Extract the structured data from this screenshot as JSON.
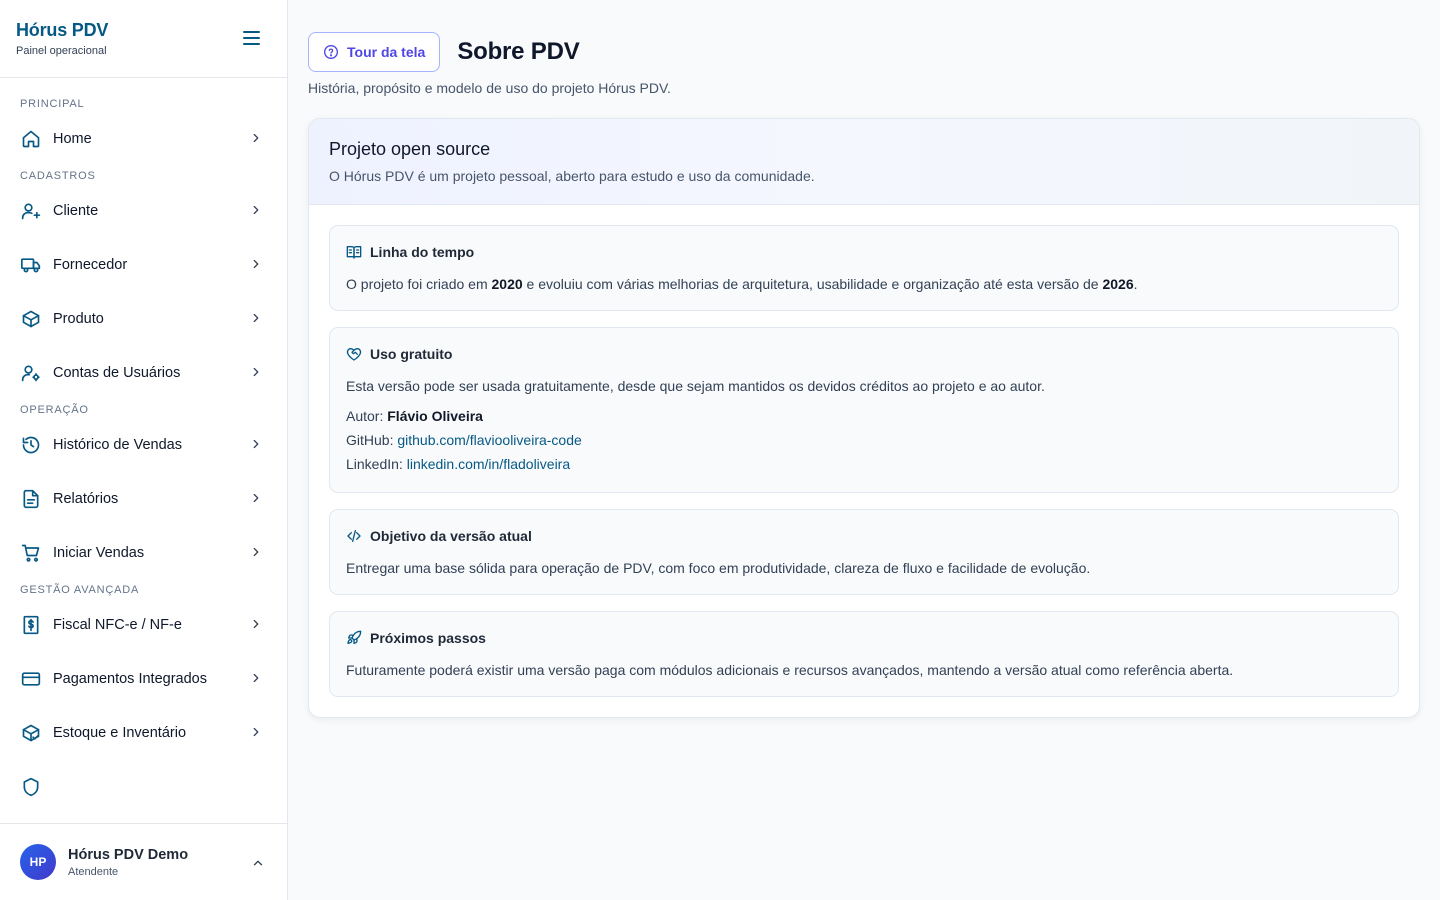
{
  "brand": {
    "title": "Hórus PDV",
    "subtitle": "Painel operacional"
  },
  "sidebar": {
    "sections": [
      {
        "title": "PRINCIPAL",
        "items": [
          {
            "label": "Home",
            "icon": "home-icon"
          }
        ]
      },
      {
        "title": "CADASTROS",
        "items": [
          {
            "label": "Cliente",
            "icon": "user-plus-icon"
          },
          {
            "label": "Fornecedor",
            "icon": "truck-icon"
          },
          {
            "label": "Produto",
            "icon": "package-icon"
          },
          {
            "label": "Contas de Usuários",
            "icon": "user-cog-icon"
          }
        ]
      },
      {
        "title": "OPERAÇÃO",
        "items": [
          {
            "label": "Histórico de Vendas",
            "icon": "history-icon"
          },
          {
            "label": "Relatórios",
            "icon": "file-text-icon"
          },
          {
            "label": "Iniciar Vendas",
            "icon": "cart-icon"
          }
        ]
      },
      {
        "title": "GESTÃO AVANÇADA",
        "items": [
          {
            "label": "Fiscal NFC-e / NF-e",
            "icon": "receipt-dollar-icon"
          },
          {
            "label": "Pagamentos Integrados",
            "icon": "credit-card-icon"
          },
          {
            "label": "Estoque e Inventário",
            "icon": "package-check-icon"
          }
        ]
      }
    ]
  },
  "user": {
    "initials": "HP",
    "name": "Hórus PDV Demo",
    "role": "Atendente"
  },
  "header": {
    "tour_label": "Tour da tela",
    "title": "Sobre PDV",
    "subtitle": "História, propósito e modelo de uso do projeto Hórus PDV."
  },
  "card": {
    "title": "Projeto open source",
    "subtitle": "O Hórus PDV é um projeto pessoal, aberto para estudo e uso da comunidade.",
    "timeline": {
      "title": "Linha do tempo",
      "text_before": "O projeto foi criado em ",
      "year_start": "2020",
      "text_middle": " e evoluiu com várias melhorias de arquitetura, usabilidade e organização até esta versão de ",
      "year_end": "2026",
      "text_after": "."
    },
    "free_use": {
      "title": "Uso gratuito",
      "text": "Esta versão pode ser usada gratuitamente, desde que sejam mantidos os devidos créditos ao projeto e ao autor.",
      "author_label": "Autor: ",
      "author_name": "Flávio Oliveira",
      "github_label": "GitHub: ",
      "github_link": "github.com/flaviooliveira-code",
      "linkedin_label": "LinkedIn: ",
      "linkedin_link": "linkedin.com/in/fladoliveira"
    },
    "goal": {
      "title": "Objetivo da versão atual",
      "text": "Entregar uma base sólida para operação de PDV, com foco em produtividade, clareza de fluxo e facilidade de evolução."
    },
    "next_steps": {
      "title": "Próximos passos",
      "text": "Futuramente poderá existir uma versão paga com módulos adicionais e recursos avançados, mantendo a versão atual como referência aberta."
    }
  },
  "colors": {
    "brand": "#075985",
    "accent": "#4f46e5",
    "border": "#e2e8f0",
    "background": "#f8fafc"
  }
}
